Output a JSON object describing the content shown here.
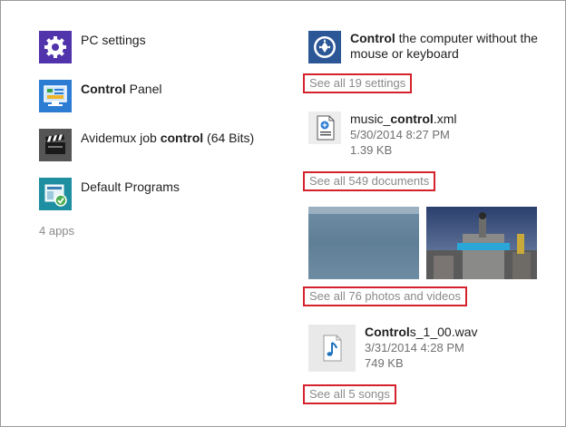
{
  "apps": {
    "items": [
      {
        "pre": "PC settings",
        "bold": "",
        "post": "",
        "icon": "gear-icon",
        "color": "#5133ab"
      },
      {
        "pre": "",
        "bold": "Control",
        "post": " Panel",
        "icon": "control-panel-icon",
        "color": "#2d7cd3"
      },
      {
        "pre": "Avidemux job ",
        "bold": "control",
        "post": " (64 Bits)",
        "icon": "clapperboard-icon",
        "color": "#555555"
      },
      {
        "pre": "Default Programs",
        "bold": "",
        "post": "",
        "icon": "default-programs-icon",
        "color": "#1d8fa1"
      }
    ],
    "count_text": "4 apps"
  },
  "settings": {
    "result_bold": "Control",
    "result_rest": " the computer without the mouse or keyboard",
    "icon": "ease-of-access-icon",
    "see_all": "See all 19 settings"
  },
  "documents": {
    "name_pre": "music_",
    "name_bold": "control",
    "name_post": ".xml",
    "date": "5/30/2014 8:27 PM",
    "size": "1.39 KB",
    "icon": "xml-document-icon",
    "see_all": "See all 549 documents"
  },
  "photos": {
    "see_all": "See all 76 photos and videos"
  },
  "songs": {
    "name_bold": "Control",
    "name_post": "s_1_00.wav",
    "date": "3/31/2014 4:28 PM",
    "size": "749 KB",
    "icon": "music-note-icon",
    "see_all": "See all 5 songs"
  },
  "colors": {
    "highlight_border": "#d5222c",
    "secondary_text": "#8a8a8a"
  }
}
